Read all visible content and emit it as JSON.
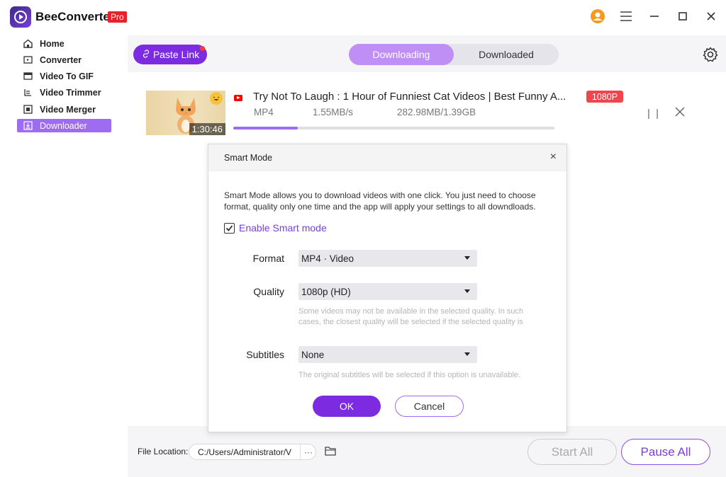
{
  "app": {
    "title": "BeeConverter",
    "badge": "Pro",
    "brand_color": "#7c2be0",
    "icons": [
      "app-logo-icon",
      "avatar-icon",
      "menu-icon",
      "minimize-icon",
      "maximize-icon",
      "close-icon"
    ]
  },
  "sidebar": {
    "items": [
      {
        "label": "Home",
        "icon": "home-icon"
      },
      {
        "label": "Converter",
        "icon": "converter-icon"
      },
      {
        "label": "Video To GIF",
        "icon": "gif-icon"
      },
      {
        "label": "Video Trimmer",
        "icon": "trim-icon"
      },
      {
        "label": "Video Merger",
        "icon": "merge-icon"
      },
      {
        "label": "Downloader",
        "icon": "download-icon",
        "active": true
      }
    ]
  },
  "toolbar": {
    "paste_label": "Paste Link",
    "tabs": [
      {
        "label": "Downloading",
        "active": true
      },
      {
        "label": "Downloaded",
        "active": false
      }
    ]
  },
  "download": {
    "title": "Try Not To Laugh : 1 Hour of Funniest Cat Videos | Best Funny A...",
    "resolution": "1080P",
    "format": "MP4",
    "speed": "1.55MB/s",
    "size": "282.98MB/1.39GB",
    "duration": "1:30:46",
    "progress_fraction": 0.2
  },
  "modal": {
    "title": "Smart Mode",
    "close_glyph": "×",
    "description": "Smart Mode allows you to download videos with one click. You just need to choose format, quality only one time and the app will apply your settings to all downdloads.",
    "enable_label": "Enable Smart mode",
    "enable_checked": true,
    "format_label": "Format",
    "format_value": "MP4 · Video",
    "quality_label": "Quality",
    "quality_value": "1080p (HD)",
    "quality_hint": "Some videos may not be available in the selected quality. In such cases, the closest  quality will be selected if the selected quality is",
    "subtitles_label": "Subtitles",
    "subtitles_value": "None",
    "subtitles_hint": "The original subtitles will be selected if this option is unavailable.",
    "ok_label": "OK",
    "cancel_label": "Cancel"
  },
  "footer": {
    "file_location_label": "File Location:",
    "file_location_value": "C:/Users/Administrator/V",
    "more_glyph": "···",
    "start_all_label": "Start All",
    "pause_all_label": "Pause All"
  }
}
